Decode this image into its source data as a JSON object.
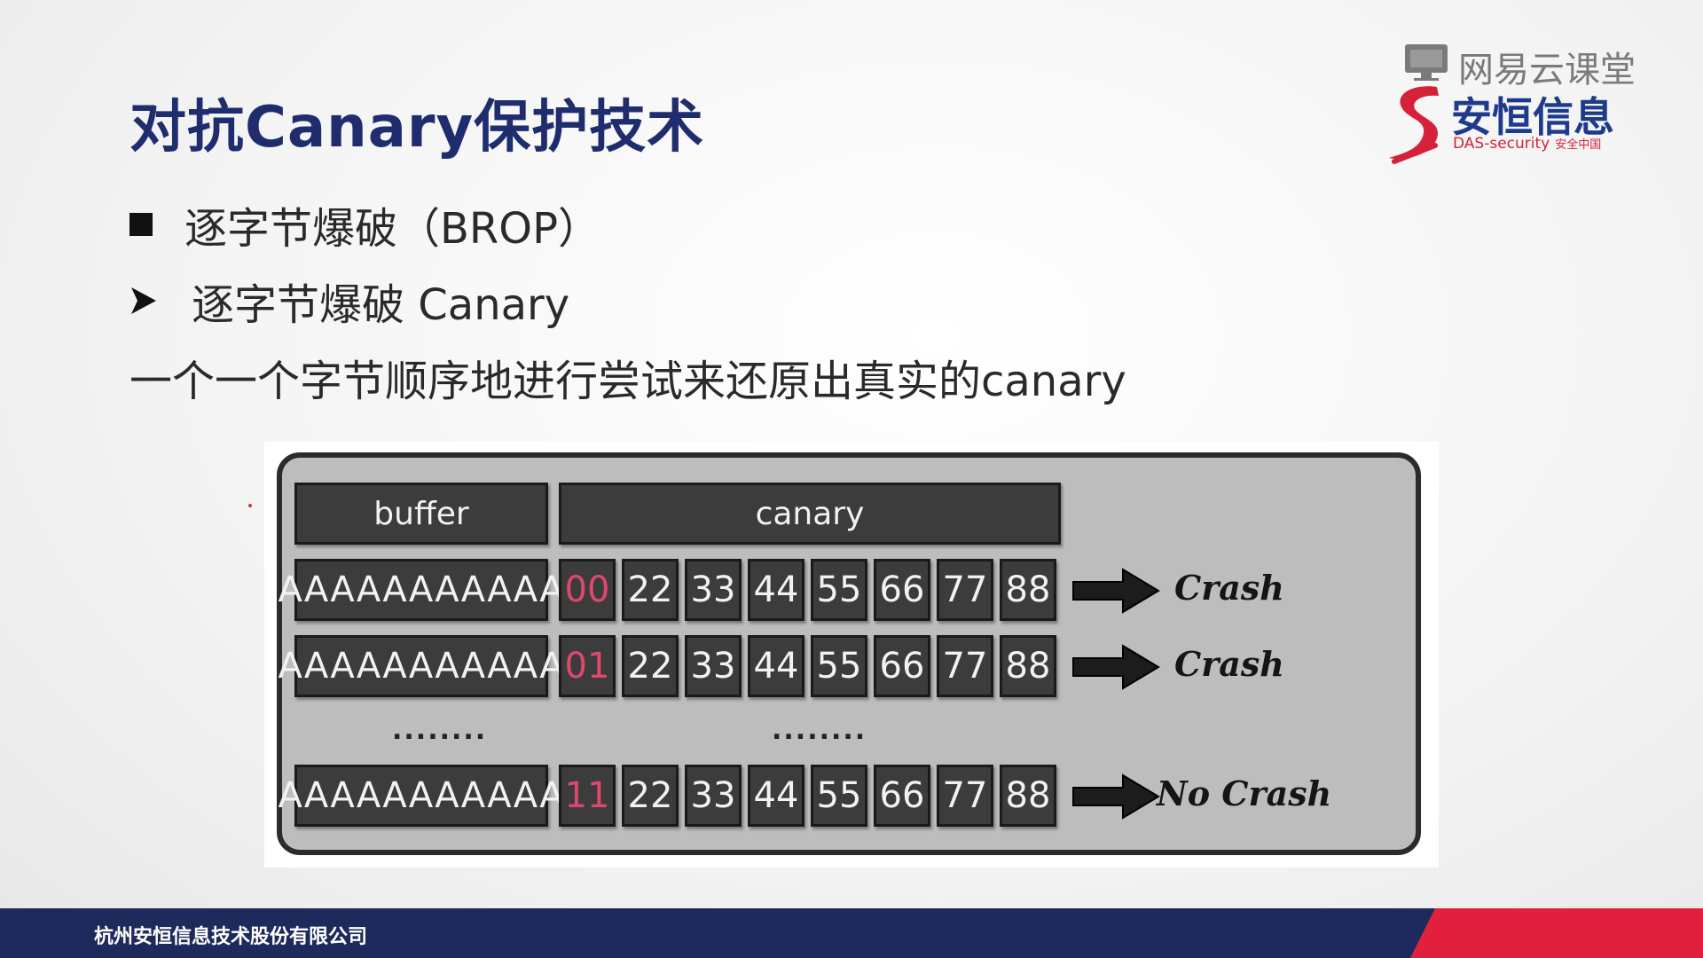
{
  "slide": {
    "title": "对抗Canary保护技术",
    "bullet1": "逐字节爆破（BROP）",
    "bullet2": "逐字节爆破 Canary",
    "description": "一个一个字节顺序地进行尝试来还原出真实的canary"
  },
  "logo": {
    "platform": "网易云课堂",
    "brand": "安恒信息",
    "sub_en": "DAS-security",
    "sub_cn": "安全中国",
    "brand_color": "#1e3a8a",
    "accent_color": "#d6213a"
  },
  "diagram": {
    "headers": {
      "buffer": "buffer",
      "canary": "canary"
    },
    "rows": [
      {
        "buffer": "AAAAAAAAAAA",
        "bytes": [
          "00",
          "22",
          "33",
          "44",
          "55",
          "66",
          "77",
          "88"
        ],
        "result": "Crash"
      },
      {
        "buffer": "AAAAAAAAAAA",
        "bytes": [
          "01",
          "22",
          "33",
          "44",
          "55",
          "66",
          "77",
          "88"
        ],
        "result": "Crash"
      },
      {
        "buffer": "AAAAAAAAAAA",
        "bytes": [
          "11",
          "22",
          "33",
          "44",
          "55",
          "66",
          "77",
          "88"
        ],
        "result": "No Crash"
      }
    ],
    "ellipsis": "........",
    "highlight_color": "#e0476d"
  },
  "footer": {
    "company": "杭州安恒信息技术股份有限公司"
  }
}
